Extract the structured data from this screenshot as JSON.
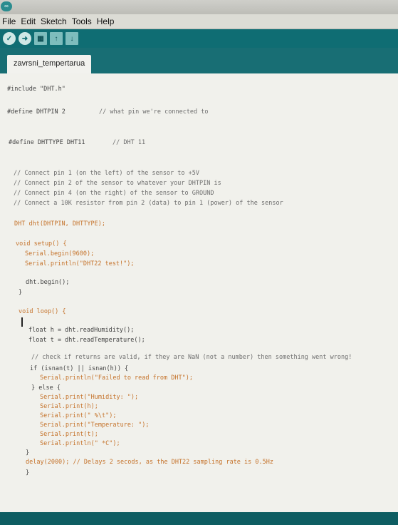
{
  "window": {
    "logo_glyph": "∞"
  },
  "menu": [
    "File",
    "Edit",
    "Sketch",
    "Tools",
    "Help"
  ],
  "toolbar": {
    "buttons": [
      {
        "name": "verify-button",
        "glyph": "✓"
      },
      {
        "name": "upload-button",
        "glyph": "➜"
      },
      {
        "name": "new-button",
        "glyph": "▦"
      },
      {
        "name": "open-button",
        "glyph": "↑"
      },
      {
        "name": "save-button",
        "glyph": "↓"
      }
    ]
  },
  "tab": {
    "label": "zavrsni_tempertarua"
  },
  "code": [
    "#include \"DHT.h\"",
    "#define DHTPIN 2",
    "// what pin we're connected to",
    "#define DHTTYPE DHT11",
    "// DHT 11",
    "// Connect pin 1 (on the left) of the sensor to +5V",
    "// Connect pin 2 of the sensor to whatever your DHTPIN is",
    "// Connect pin 4 (on the right) of the sensor to GROUND",
    "// Connect a 10K resistor from pin 2 (data) to pin 1 (power) of the sensor",
    "DHT dht(DHTPIN, DHTTYPE);",
    "void setup() {",
    "Serial.begin(9600);",
    "Serial.println(\"DHT22 test!\");",
    "dht.begin();",
    "}",
    "void loop() {",
    "float h = dht.readHumidity();",
    "float t = dht.readTemperature();",
    "// check if returns are valid, if they are NaN (not a number) then something went wrong!",
    "if (isnan(t) || isnan(h)) {",
    "Serial.println(\"Failed to read from DHT\");",
    "} else {",
    "Serial.print(\"Humidity: \");",
    "Serial.print(h);",
    "Serial.print(\" %\\t\");",
    "Serial.print(\"Temperature: \");",
    "Serial.print(t);",
    "Serial.println(\" *C\");",
    "}",
    "delay(2000); // Delays 2 secods, as the DHT22 sampling rate is 0.5Hz",
    "}"
  ],
  "colors": {
    "toolbar": "#0f6d73",
    "keyword": "#c5732b",
    "editor_bg": "#f1f1ec"
  }
}
